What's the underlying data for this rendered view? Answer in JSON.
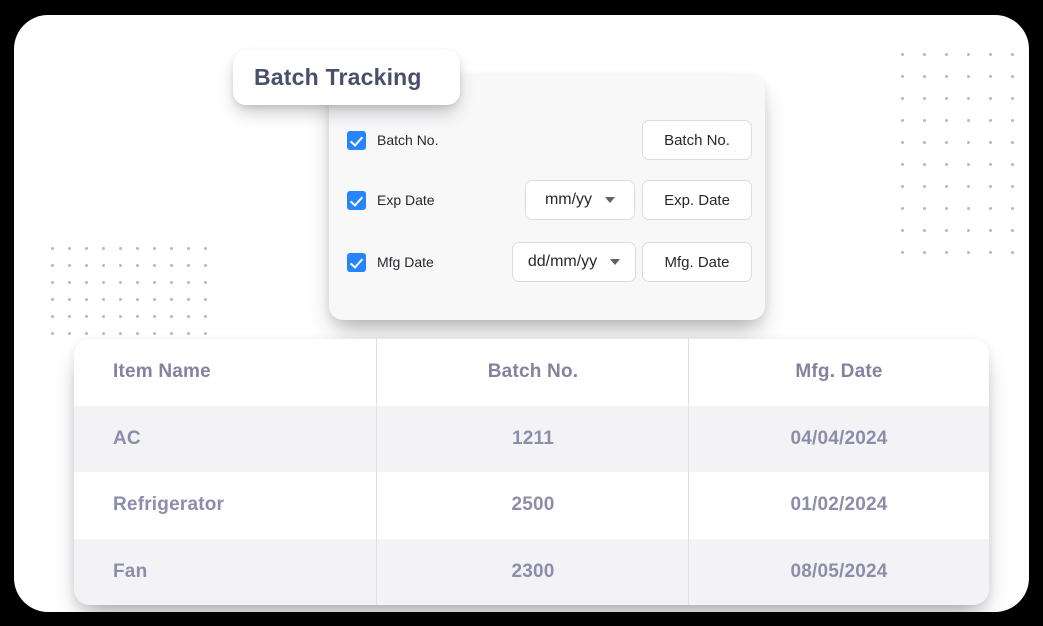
{
  "tab": {
    "label": "Batch Tracking"
  },
  "form": {
    "rows": [
      {
        "checkbox_checked": true,
        "label": "Batch No.",
        "format": null,
        "pill": "Batch No."
      },
      {
        "checkbox_checked": true,
        "label": "Exp Date",
        "format": "mm/yy",
        "pill": "Exp. Date"
      },
      {
        "checkbox_checked": true,
        "label": "Mfg Date",
        "format": "dd/mm/yy",
        "pill": "Mfg. Date"
      }
    ]
  },
  "table": {
    "columns": [
      "Item Name",
      "Batch No.",
      "Mfg. Date"
    ],
    "rows": [
      {
        "item": "AC",
        "batch": "1211",
        "mfg": "04/04/2024"
      },
      {
        "item": "Refrigerator",
        "batch": "2500",
        "mfg": "01/02/2024"
      },
      {
        "item": "Fan",
        "batch": "2300",
        "mfg": "08/05/2024"
      }
    ]
  },
  "colors": {
    "accent_checkbox": "#2684fc",
    "heading_text": "#83839f",
    "cell_text": "#8d8dab",
    "tab_text": "#4a4f6b",
    "row_alt_bg": "#f3f3f5",
    "panel_bg": "#f8f8f9",
    "page_bg": "#000000"
  },
  "decor": {
    "dots_right": {
      "cols": 6,
      "rows": 10,
      "spacing": 22
    },
    "dots_left": {
      "cols": 10,
      "rows": 6,
      "spacing": 17
    }
  }
}
